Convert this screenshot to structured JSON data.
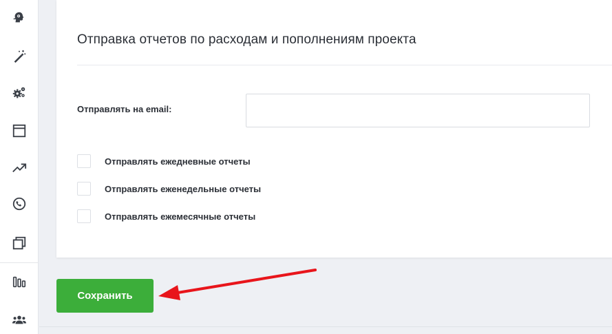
{
  "sidebar": {
    "items": [
      {
        "icon": "brain-head-icon"
      },
      {
        "icon": "magic-wand-icon"
      },
      {
        "icon": "gears-icon"
      },
      {
        "icon": "browser-window-icon"
      },
      {
        "icon": "trending-up-icon"
      },
      {
        "icon": "phone-icon"
      },
      {
        "icon": "copy-icon"
      },
      {
        "icon": "bar-chart-icon"
      },
      {
        "icon": "users-icon"
      }
    ]
  },
  "report_settings": {
    "title": "Отправка отчетов по расходам и пополнениям проекта",
    "email_label": "Отправлять на email:",
    "email_value": "",
    "options": [
      {
        "label": "Отправлять ежедневные отчеты",
        "checked": false
      },
      {
        "label": "Отправлять еженедельные отчеты",
        "checked": false
      },
      {
        "label": "Отправлять ежемесячные отчеты",
        "checked": false
      }
    ]
  },
  "actions": {
    "save_label": "Сохранить"
  },
  "colors": {
    "save_button": "#3cae3a",
    "annotation_arrow": "#e8151b",
    "sidebar_icon": "#3a3f47"
  }
}
